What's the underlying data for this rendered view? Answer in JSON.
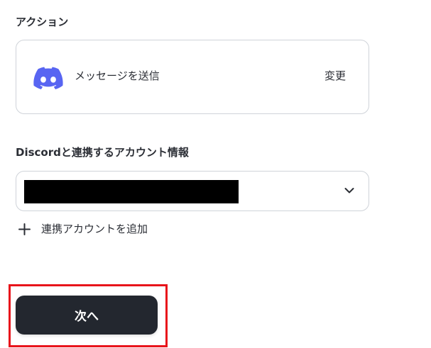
{
  "action_section": {
    "label": "アクション",
    "card": {
      "icon": "discord-icon",
      "title": "メッセージを送信",
      "change_label": "変更"
    }
  },
  "account_section": {
    "label": "Discordと連携するアカウント情報",
    "select": {
      "value_redacted": true
    },
    "add_account_label": "連携アカウントを追加"
  },
  "footer": {
    "next_label": "次へ"
  },
  "colors": {
    "text": "#2b2e35",
    "border": "#cfd3d9",
    "discord_brand": "#5865f2",
    "button_bg": "#23272f",
    "highlight": "#e8141b"
  }
}
